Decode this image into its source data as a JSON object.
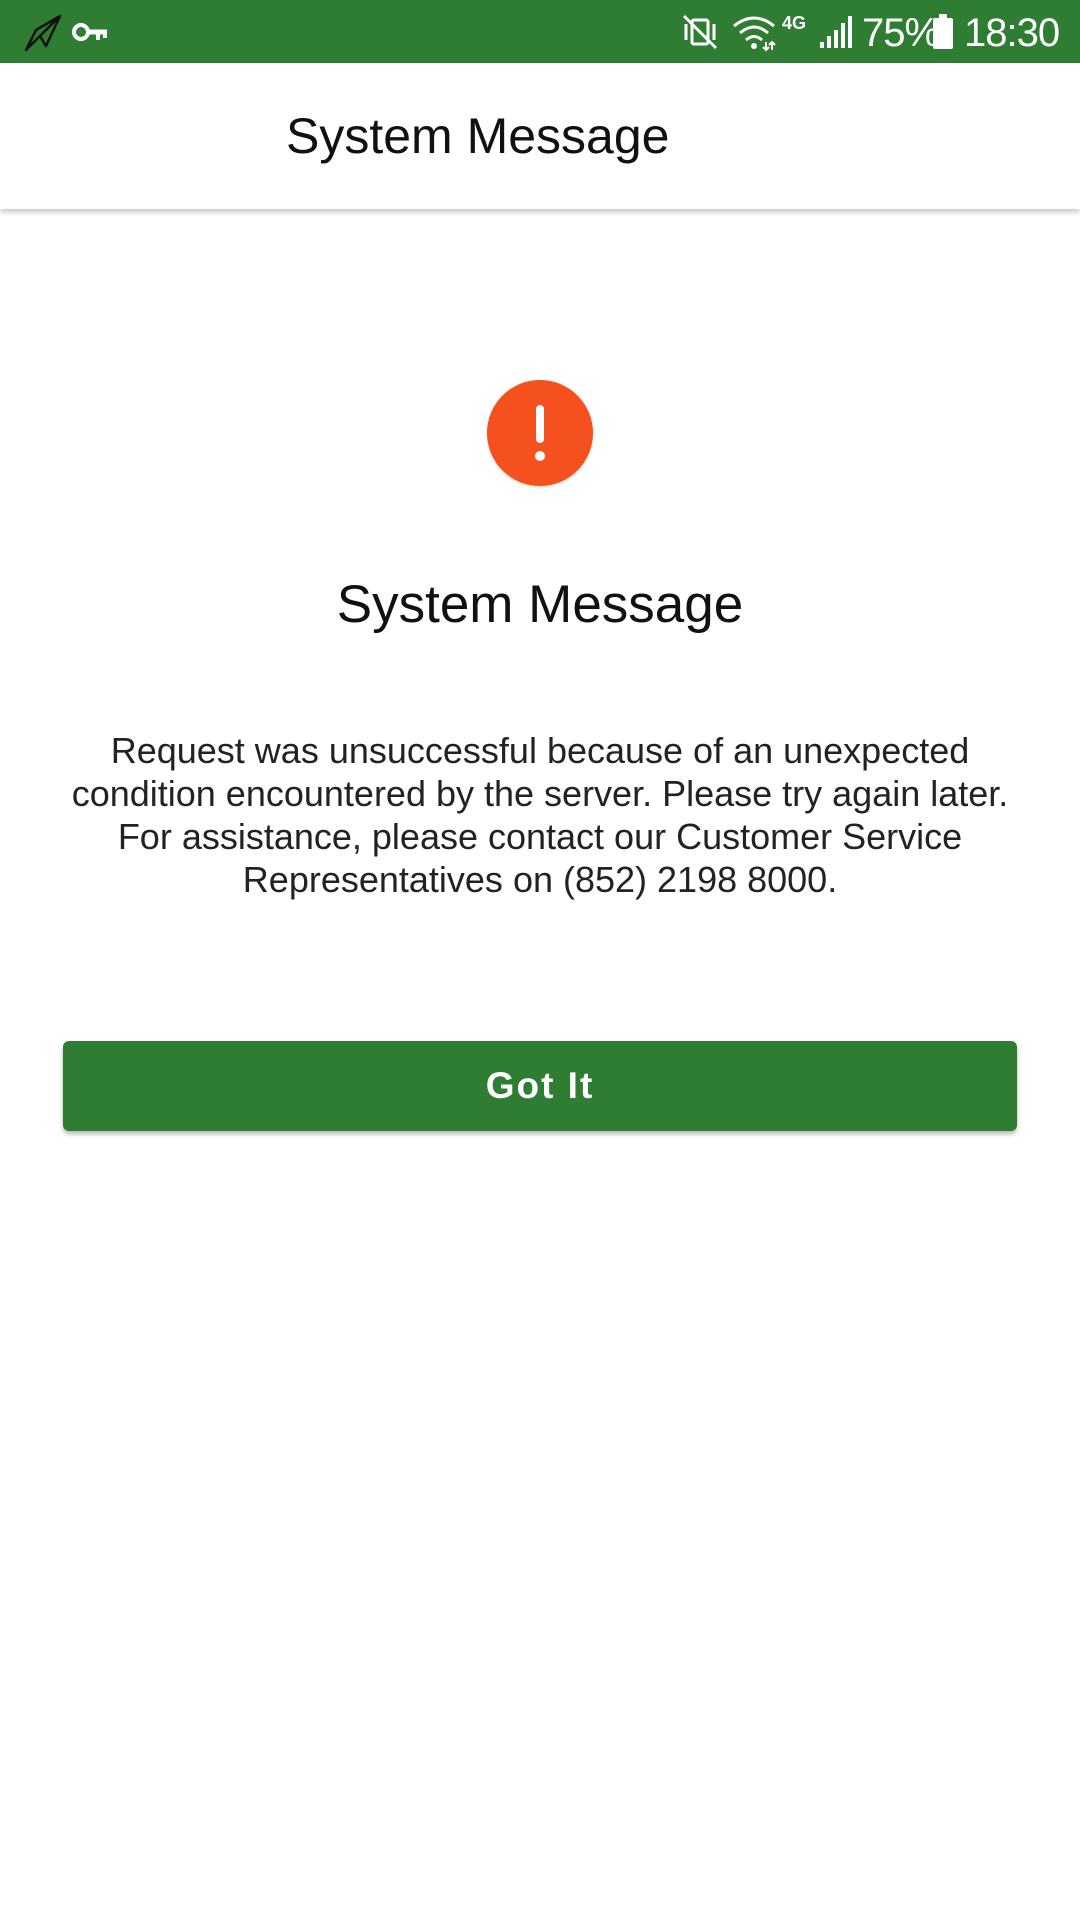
{
  "status_bar": {
    "background": "#2e7d32",
    "left_icons": [
      "paper-plane-icon",
      "vpn-key-icon"
    ],
    "right_icons": [
      "vibrate-mute-icon",
      "wifi-icon",
      "signal-icon",
      "battery-icon"
    ],
    "network_label": "4G",
    "battery_percent": "75%",
    "time": "18:30"
  },
  "app_bar": {
    "title": "System Message"
  },
  "dialog": {
    "icon": "alert-exclamation-icon",
    "icon_color": "#f4511e",
    "title": "System Message",
    "message": "Request was unsuccessful because of an unexpected condition encountered by the server. Please try again later. For assistance, please contact our Customer Service Representatives on (852) 2198 8000.",
    "button_label": "Got It",
    "button_color": "#2e7d32"
  }
}
